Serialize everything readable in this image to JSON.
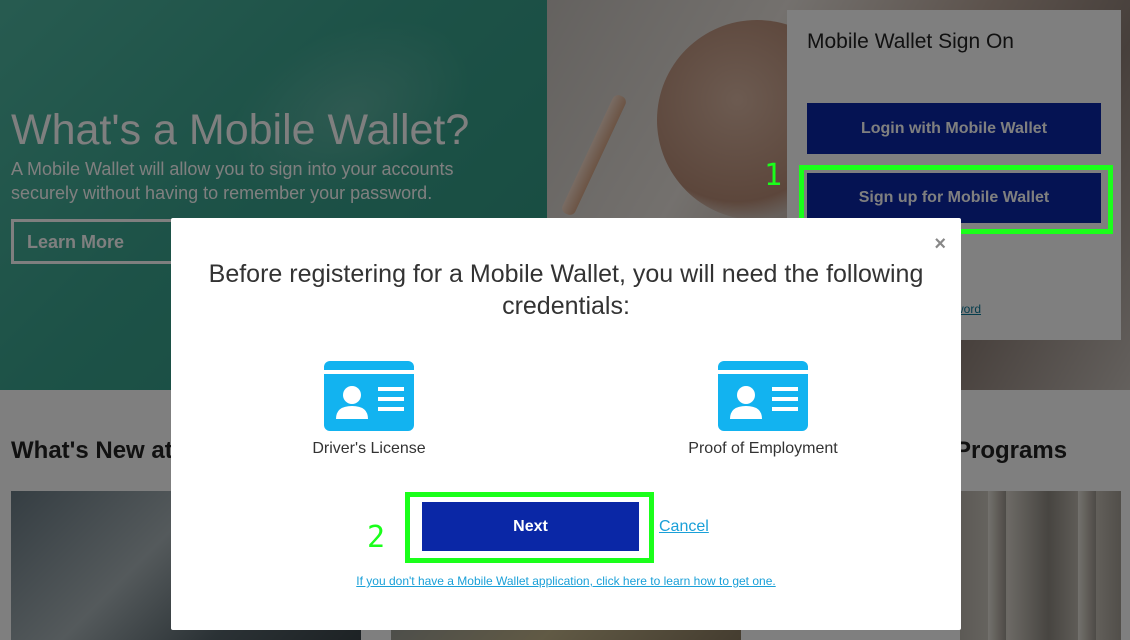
{
  "hero": {
    "title": "What's a Mobile Wallet?",
    "subtitle": "A Mobile Wallet will allow you to sign into your accounts securely without having to remember your password.",
    "learn_more_label": "Learn More"
  },
  "signon_panel": {
    "title": "Mobile Wallet Sign On",
    "login_label": "Login with Mobile Wallet",
    "signup_label": "Sign up for Mobile Wallet",
    "partial_link_text": "word"
  },
  "sections": {
    "left_heading_partial": "What's New at",
    "right_heading_partial": "Programs"
  },
  "modal": {
    "close_glyph": "×",
    "heading": "Before registering for a Mobile Wallet, you will need the following credentials:",
    "credentials": [
      {
        "label": "Driver's License",
        "icon": "id-card-icon"
      },
      {
        "label": "Proof of Employment",
        "icon": "id-card-icon"
      }
    ],
    "next_label": "Next",
    "cancel_label": "Cancel",
    "help_link": "If you don't have a Mobile Wallet application, click here to learn how to get one."
  },
  "annotations": [
    {
      "number": "1",
      "target": "signup-button"
    },
    {
      "number": "2",
      "target": "next-button"
    }
  ],
  "colors": {
    "primary_button": "#0a27a6",
    "link": "#1aa0d8",
    "annotation": "#1aff1a",
    "hero_teal": "#3aa48f",
    "icon_blue": "#12b3f0"
  }
}
